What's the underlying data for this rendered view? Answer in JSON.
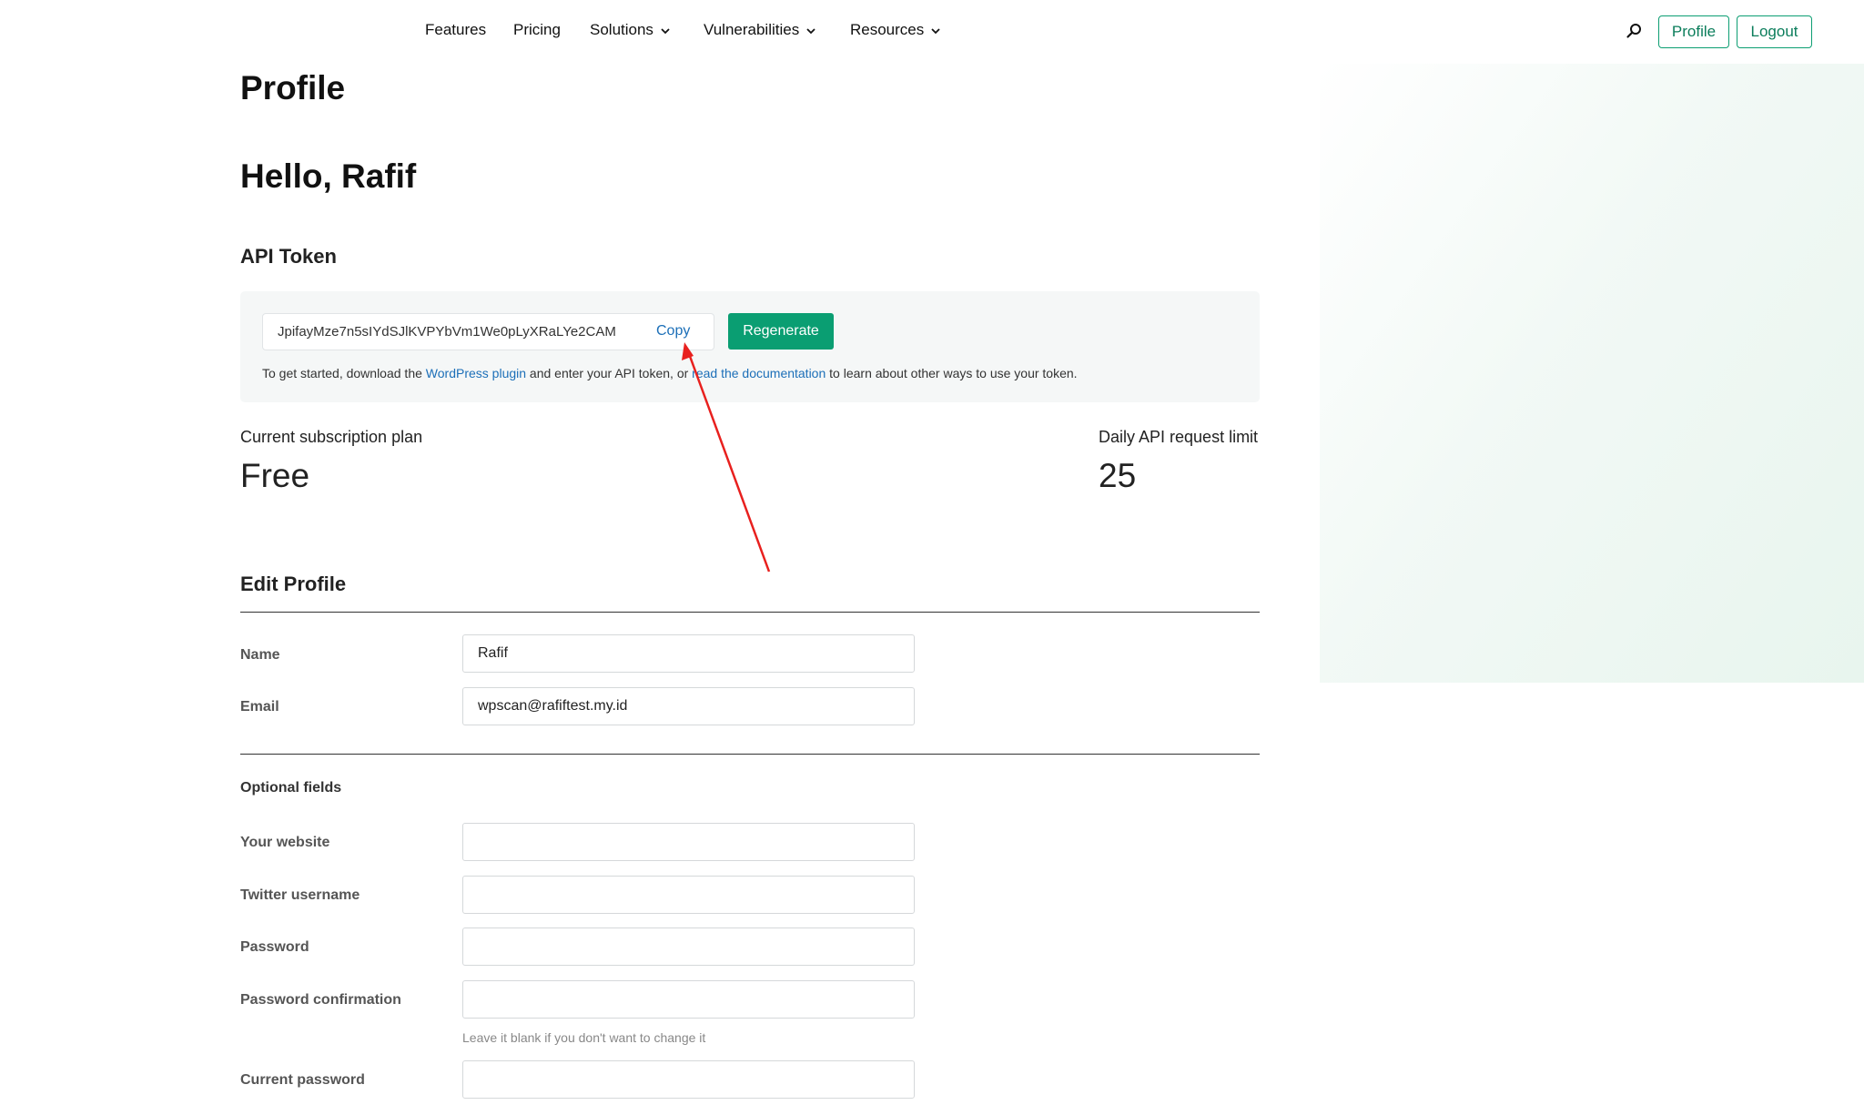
{
  "nav": {
    "links": [
      "Features",
      "Pricing",
      "Solutions",
      "Vulnerabilities",
      "Resources"
    ],
    "profile_label": "Profile",
    "logout_label": "Logout"
  },
  "page_title": "Profile",
  "greeting": "Hello, Rafif",
  "api_token": {
    "heading": "API Token",
    "token": "JpifayMze7n5sIYdSJlKVPYbVm1We0pLyXRaLYe2CAM",
    "copy_label": "Copy",
    "regenerate_label": "Regenerate",
    "help_prefix": "To get started, download the ",
    "help_link1": "WordPress plugin",
    "help_middle": " and enter your API token, or ",
    "help_link2": "read the documentation",
    "help_suffix": " to learn about other ways to use your token."
  },
  "subscription": {
    "plan_label": "Current subscription plan",
    "plan_value": "Free",
    "limit_label": "Daily API request limit",
    "limit_value": "25"
  },
  "edit_profile": {
    "heading": "Edit Profile",
    "name_label": "Name",
    "name_value": "Rafif",
    "email_label": "Email",
    "email_value": "wpscan@rafiftest.my.id"
  },
  "optional": {
    "heading": "Optional fields",
    "website_label": "Your website",
    "twitter_label": "Twitter username",
    "password_label": "Password",
    "password_confirm_label": "Password confirmation",
    "password_hint": "Leave it blank if you don't want to change it",
    "current_password_label": "Current password"
  },
  "colors": {
    "accent": "#0a9e72",
    "link": "#1c6fb8",
    "annotation_arrow": "#e8201e"
  }
}
